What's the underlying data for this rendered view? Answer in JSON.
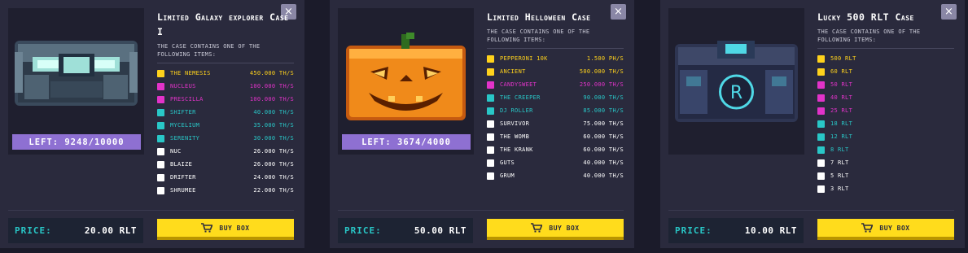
{
  "colors": {
    "yellow": "#ffd21c",
    "pink": "#e233c9",
    "cyan": "#29c7c7",
    "white": "#ffffff"
  },
  "cards": [
    {
      "title": "Limited Galaxy explorer Case I",
      "description": "The case contains one of the following items:",
      "left_label": "LEFT: 9248/10000",
      "price_label": "PRICE:",
      "price_value": "20.00 RLT",
      "buy_label": "BUY BOX",
      "close_symbol": "×",
      "items": [
        {
          "name": "The Nemesis",
          "value": "450.000 Th/s",
          "color": "#ffd21c"
        },
        {
          "name": "Nucleus",
          "value": "100.000 Th/s",
          "color": "#e233c9"
        },
        {
          "name": "Prescilla",
          "value": "100.000 Th/s",
          "color": "#e233c9"
        },
        {
          "name": "Shifter",
          "value": "40.000 Th/s",
          "color": "#29c7c7"
        },
        {
          "name": "Mycelium",
          "value": "35.000 Th/s",
          "color": "#29c7c7"
        },
        {
          "name": "Serenity",
          "value": "30.000 Th/s",
          "color": "#29c7c7"
        },
        {
          "name": "Nuc",
          "value": "26.000 Th/s",
          "color": "#ffffff"
        },
        {
          "name": "Blaize",
          "value": "26.000 Th/s",
          "color": "#ffffff"
        },
        {
          "name": "Drifter",
          "value": "24.000 Th/s",
          "color": "#ffffff"
        },
        {
          "name": "Shrumee",
          "value": "22.000 Th/s",
          "color": "#ffffff"
        }
      ]
    },
    {
      "title": "Limited Helloween Case",
      "description": "The case contains one of the following items:",
      "left_label": "LEFT: 3674/4000",
      "price_label": "PRICE:",
      "price_value": "50.00 RLT",
      "buy_label": "BUY BOX",
      "close_symbol": "×",
      "items": [
        {
          "name": "Pepperoni 10K",
          "value": "1.500 Ph/s",
          "color": "#ffd21c"
        },
        {
          "name": "Ancient",
          "value": "500.000 Th/s",
          "color": "#ffd21c"
        },
        {
          "name": "Candysweet",
          "value": "250.000 Th/s",
          "color": "#e233c9"
        },
        {
          "name": "The Creeper",
          "value": "90.000 Th/s",
          "color": "#29c7c7"
        },
        {
          "name": "DJ Roller",
          "value": "85.000 Th/s",
          "color": "#29c7c7"
        },
        {
          "name": "Survivor",
          "value": "75.000 Th/s",
          "color": "#ffffff"
        },
        {
          "name": "The Womb",
          "value": "60.000 Th/s",
          "color": "#ffffff"
        },
        {
          "name": "The Krank",
          "value": "60.000 Th/s",
          "color": "#ffffff"
        },
        {
          "name": "Guts",
          "value": "40.000 Th/s",
          "color": "#ffffff"
        },
        {
          "name": "Grum",
          "value": "40.000 Th/s",
          "color": "#ffffff"
        }
      ]
    },
    {
      "title": "Lucky 500 RLT Case",
      "description": "The case contains one of the following items:",
      "left_label": "",
      "price_label": "PRICE:",
      "price_value": "10.00 RLT",
      "buy_label": "BUY BOX",
      "close_symbol": "×",
      "items": [
        {
          "name": "500 RLT",
          "value": "",
          "color": "#ffd21c"
        },
        {
          "name": "60 RLT",
          "value": "",
          "color": "#ffd21c"
        },
        {
          "name": "50 RLT",
          "value": "",
          "color": "#e233c9"
        },
        {
          "name": "40 RLT",
          "value": "",
          "color": "#e233c9"
        },
        {
          "name": "25 RLT",
          "value": "",
          "color": "#e233c9"
        },
        {
          "name": "18 RLT",
          "value": "",
          "color": "#29c7c7"
        },
        {
          "name": "12 RLT",
          "value": "",
          "color": "#29c7c7"
        },
        {
          "name": "8 RLT",
          "value": "",
          "color": "#29c7c7"
        },
        {
          "name": "7 RLT",
          "value": "",
          "color": "#ffffff"
        },
        {
          "name": "5 RLT",
          "value": "",
          "color": "#ffffff"
        },
        {
          "name": "3 RLT",
          "value": "",
          "color": "#ffffff"
        }
      ]
    }
  ]
}
